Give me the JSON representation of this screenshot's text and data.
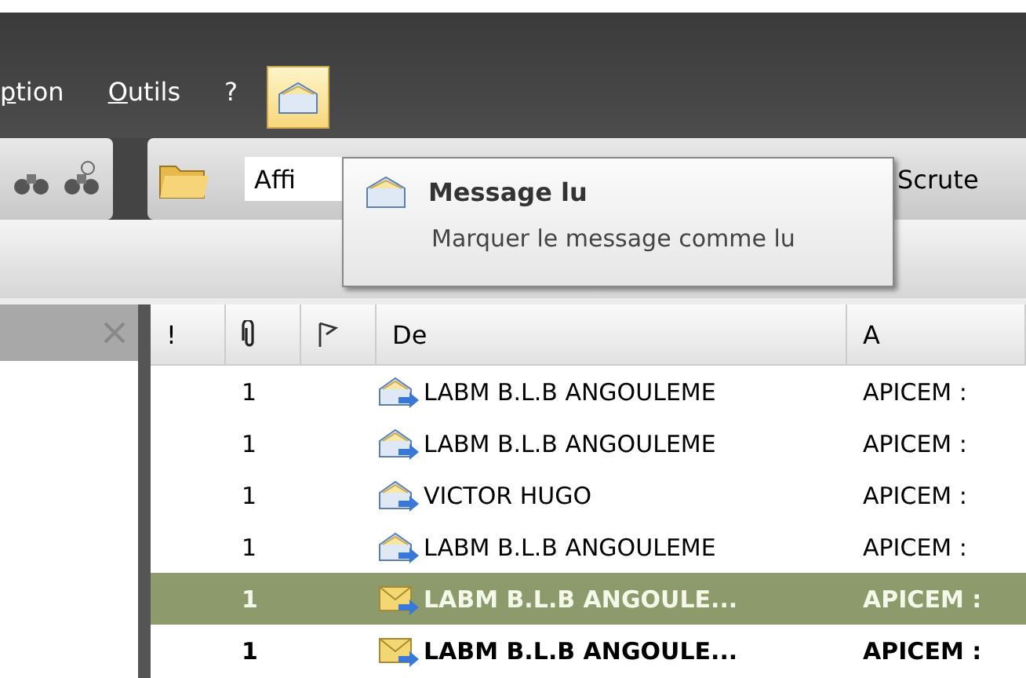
{
  "menu": [
    {
      "label": "ption"
    },
    {
      "label": "Outils"
    },
    {
      "label": "?"
    }
  ],
  "toolbar": {
    "combo_value": "Affi",
    "button": "Scrute"
  },
  "tooltip": {
    "title": "Message lu",
    "text": "Marquer le message comme lu"
  },
  "table": {
    "columns": [
      "!",
      "",
      "",
      "De",
      "A"
    ],
    "rows": [
      {
        "count": "1",
        "from": "LABM B.L.B ANGOULEME",
        "to": "APICEM :",
        "unread": false,
        "selected": false
      },
      {
        "count": "1",
        "from": "LABM B.L.B ANGOULEME",
        "to": "APICEM :",
        "unread": false,
        "selected": false
      },
      {
        "count": "1",
        "from": "VICTOR HUGO",
        "to": "APICEM :",
        "unread": false,
        "selected": false
      },
      {
        "count": "1",
        "from": "LABM B.L.B ANGOULEME",
        "to": "APICEM :",
        "unread": false,
        "selected": false
      },
      {
        "count": "1",
        "from": "LABM B.L.B ANGOULE...",
        "to": "APICEM :",
        "unread": true,
        "selected": true
      },
      {
        "count": "1",
        "from": "LABM B.L.B ANGOULE...",
        "to": "APICEM :",
        "unread": true,
        "selected": false
      }
    ]
  }
}
